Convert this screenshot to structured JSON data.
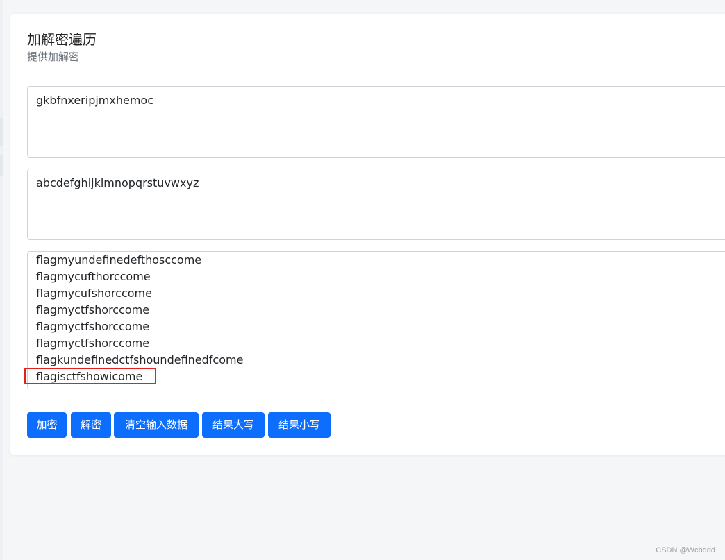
{
  "header": {
    "title": "加解密遍历",
    "subtitle": "提供加解密"
  },
  "inputs": {
    "key": "gkbfnxeripjmxhemoc",
    "alphabet": "abcdefghijklmnopqrstuvwxyz"
  },
  "results": [
    "flagmyundefinedefthosccome",
    "flagmycufthorccome",
    "flagmycufshorccome",
    "flagmyctfshorccome",
    "flagmyctfshorccome",
    "flagmyctfshorccome",
    "flagkundefinedctfshoundefinedfcome",
    "flagisctfshowicome"
  ],
  "buttons": {
    "encrypt": "加密",
    "decrypt": "解密",
    "clear": "清空输入数据",
    "upper": "结果大写",
    "lower": "结果小写"
  },
  "colors": {
    "primary": "#0d6efd",
    "highlight": "#e0221f"
  },
  "watermark": "CSDN @Wcbddd"
}
